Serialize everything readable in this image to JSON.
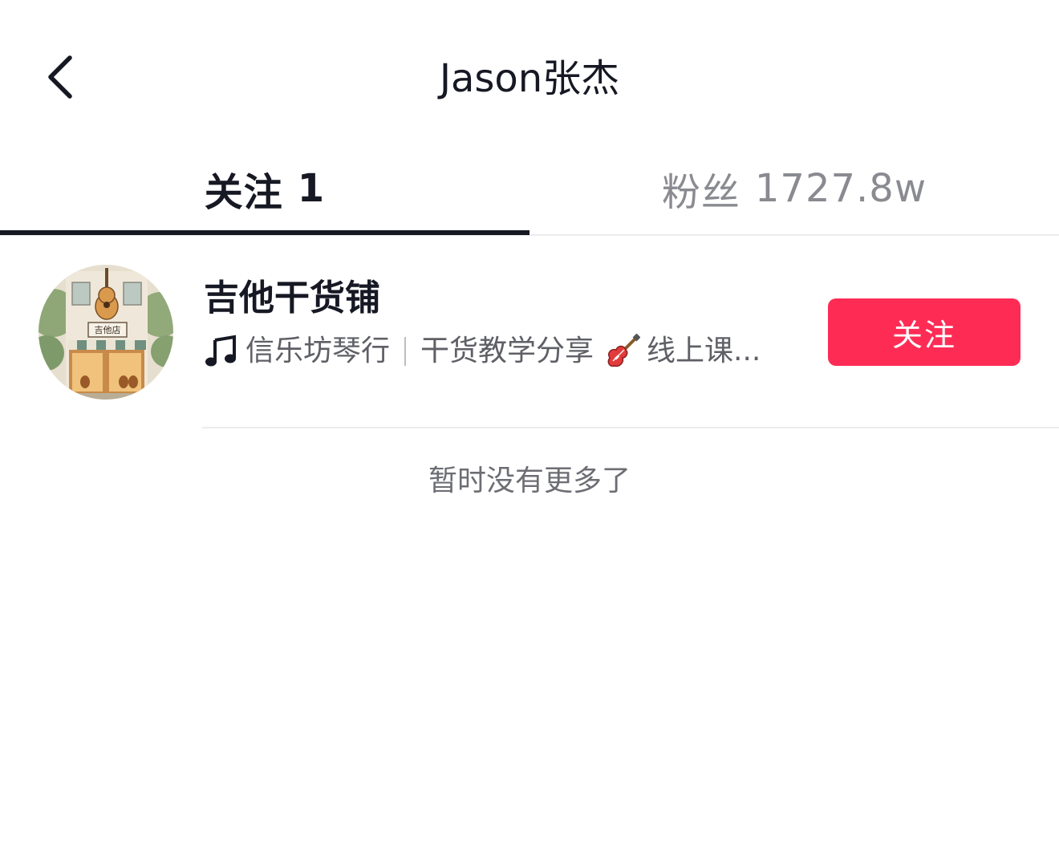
{
  "header": {
    "title": "Jason张杰",
    "back_icon": "chevron-left-icon"
  },
  "tabs": [
    {
      "label": "关注",
      "count": "1",
      "active": true
    },
    {
      "label": "粉丝",
      "count": "1727.8w",
      "active": false
    }
  ],
  "list": {
    "items": [
      {
        "name": "吉他干货铺",
        "desc_part1": "信乐坊琴行",
        "desc_part2": "干货教学分享",
        "desc_part3": "线上课...",
        "desc_icon1": "music-note-icon",
        "desc_icon2": "guitar-icon",
        "button_label": "关注"
      }
    ],
    "end_text": "暂时没有更多了"
  },
  "colors": {
    "accent": "#fe2c55",
    "text_primary": "#161823",
    "text_secondary": "#8a8b91"
  }
}
